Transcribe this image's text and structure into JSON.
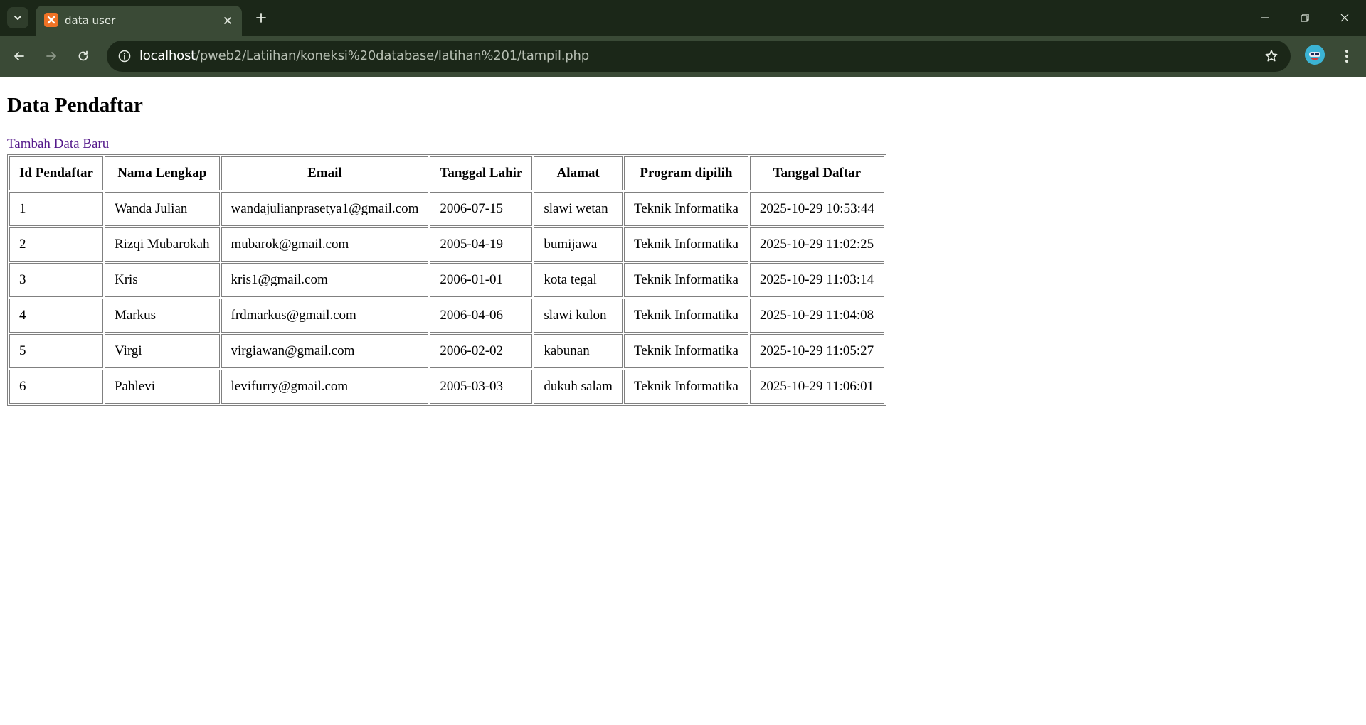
{
  "browser": {
    "tab": {
      "title": "data user"
    },
    "url": {
      "host": "localhost",
      "path": "/pweb2/Latiihan/koneksi%20database/latihan%201/tampil.php"
    }
  },
  "page": {
    "heading": "Data Pendaftar",
    "add_link": "Tambah Data Baru",
    "table": {
      "headers": [
        "Id Pendaftar",
        "Nama Lengkap",
        "Email",
        "Tanggal Lahir",
        "Alamat",
        "Program dipilih",
        "Tanggal Daftar"
      ],
      "rows": [
        [
          "1",
          "Wanda Julian",
          "wandajulianprasetya1@gmail.com",
          "2006-07-15",
          "slawi wetan",
          "Teknik Informatika",
          "2025-10-29 10:53:44"
        ],
        [
          "2",
          "Rizqi Mubarokah",
          "mubarok@gmail.com",
          "2005-04-19",
          "bumijawa",
          "Teknik Informatika",
          "2025-10-29 11:02:25"
        ],
        [
          "3",
          "Kris",
          "kris1@gmail.com",
          "2006-01-01",
          "kota tegal",
          "Teknik Informatika",
          "2025-10-29 11:03:14"
        ],
        [
          "4",
          "Markus",
          "frdmarkus@gmail.com",
          "2006-04-06",
          "slawi kulon",
          "Teknik Informatika",
          "2025-10-29 11:04:08"
        ],
        [
          "5",
          "Virgi",
          "virgiawan@gmail.com",
          "2006-02-02",
          "kabunan",
          "Teknik Informatika",
          "2025-10-29 11:05:27"
        ],
        [
          "6",
          "Pahlevi",
          "levifurry@gmail.com",
          "2005-03-03",
          "dukuh salam",
          "Teknik Informatika",
          "2025-10-29 11:06:01"
        ]
      ]
    }
  },
  "colors": {
    "tabstrip": "#1b2718",
    "toolbar": "#3a4a36",
    "visited_link": "#551a8b"
  }
}
